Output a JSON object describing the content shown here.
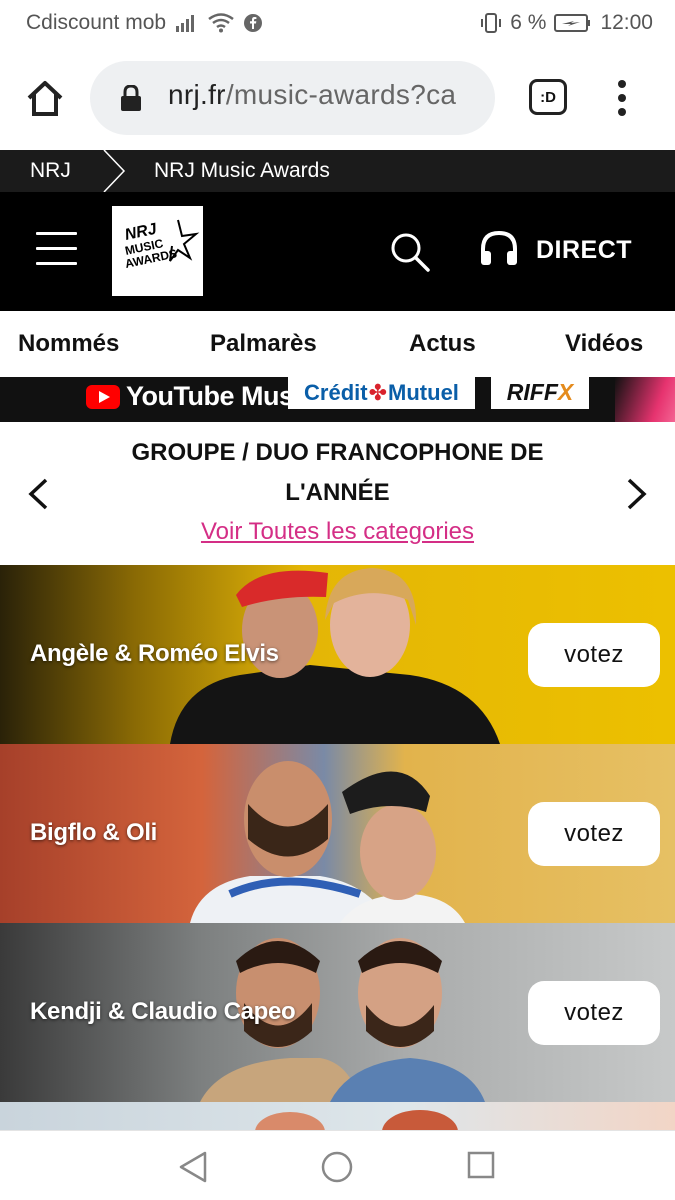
{
  "status_bar": {
    "carrier": "Cdiscount mob",
    "battery": "6 %",
    "time": "12:00"
  },
  "browser": {
    "url_domain": "nrj.fr",
    "url_path": "/music-awards?ca",
    "tabs_label": ":D"
  },
  "breadcrumb": {
    "items": [
      "NRJ",
      "NRJ Music Awards"
    ]
  },
  "header": {
    "logo_text": [
      "NRJ",
      "MUSIC",
      "AWARDS"
    ],
    "direct_label": "DIRECT"
  },
  "nav": {
    "items": [
      "Nommés",
      "Palmarès",
      "Actus",
      "Vidéos"
    ]
  },
  "sponsors": {
    "youtube": "YouTube Music",
    "credit_mutuel_a": "Crédit",
    "credit_mutuel_b": "Mutuel",
    "riff": "RIFF",
    "riff_x": "X"
  },
  "category": {
    "title": "GROUPE / DUO FRANCOPHONE DE L'ANNÉE",
    "see_all": "Voir Toutes les categories"
  },
  "nominees": [
    {
      "name": "Angèle & Roméo Elvis",
      "vote_label": "votez"
    },
    {
      "name": "Bigflo & Oli",
      "vote_label": "votez"
    },
    {
      "name": "Kendji & Claudio Capeo",
      "vote_label": "votez"
    }
  ],
  "colors": {
    "accent_pink": "#d42e86",
    "header_bg": "#000000",
    "breadcrumb_bg": "#1b1b1b"
  }
}
